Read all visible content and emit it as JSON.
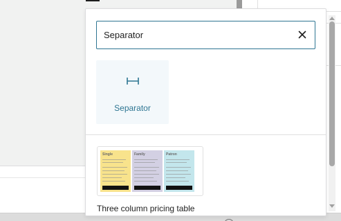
{
  "search": {
    "value": "Separator",
    "clear_icon": "close-icon"
  },
  "results": {
    "blocks": [
      {
        "label": "Separator",
        "icon": "separator-icon"
      }
    ],
    "patterns": [
      {
        "label": "Three column pricing table",
        "columns": [
          {
            "title": "Single",
            "color": "#f8e38c"
          },
          {
            "title": "Family",
            "color": "#d3d0e3"
          },
          {
            "title": "Patron",
            "color": "#c3e6ec"
          }
        ]
      }
    ]
  },
  "colors": {
    "accent": "#2d7592",
    "tile_background": "#f3f8fb",
    "canvas_background": "#f1f2f1"
  }
}
